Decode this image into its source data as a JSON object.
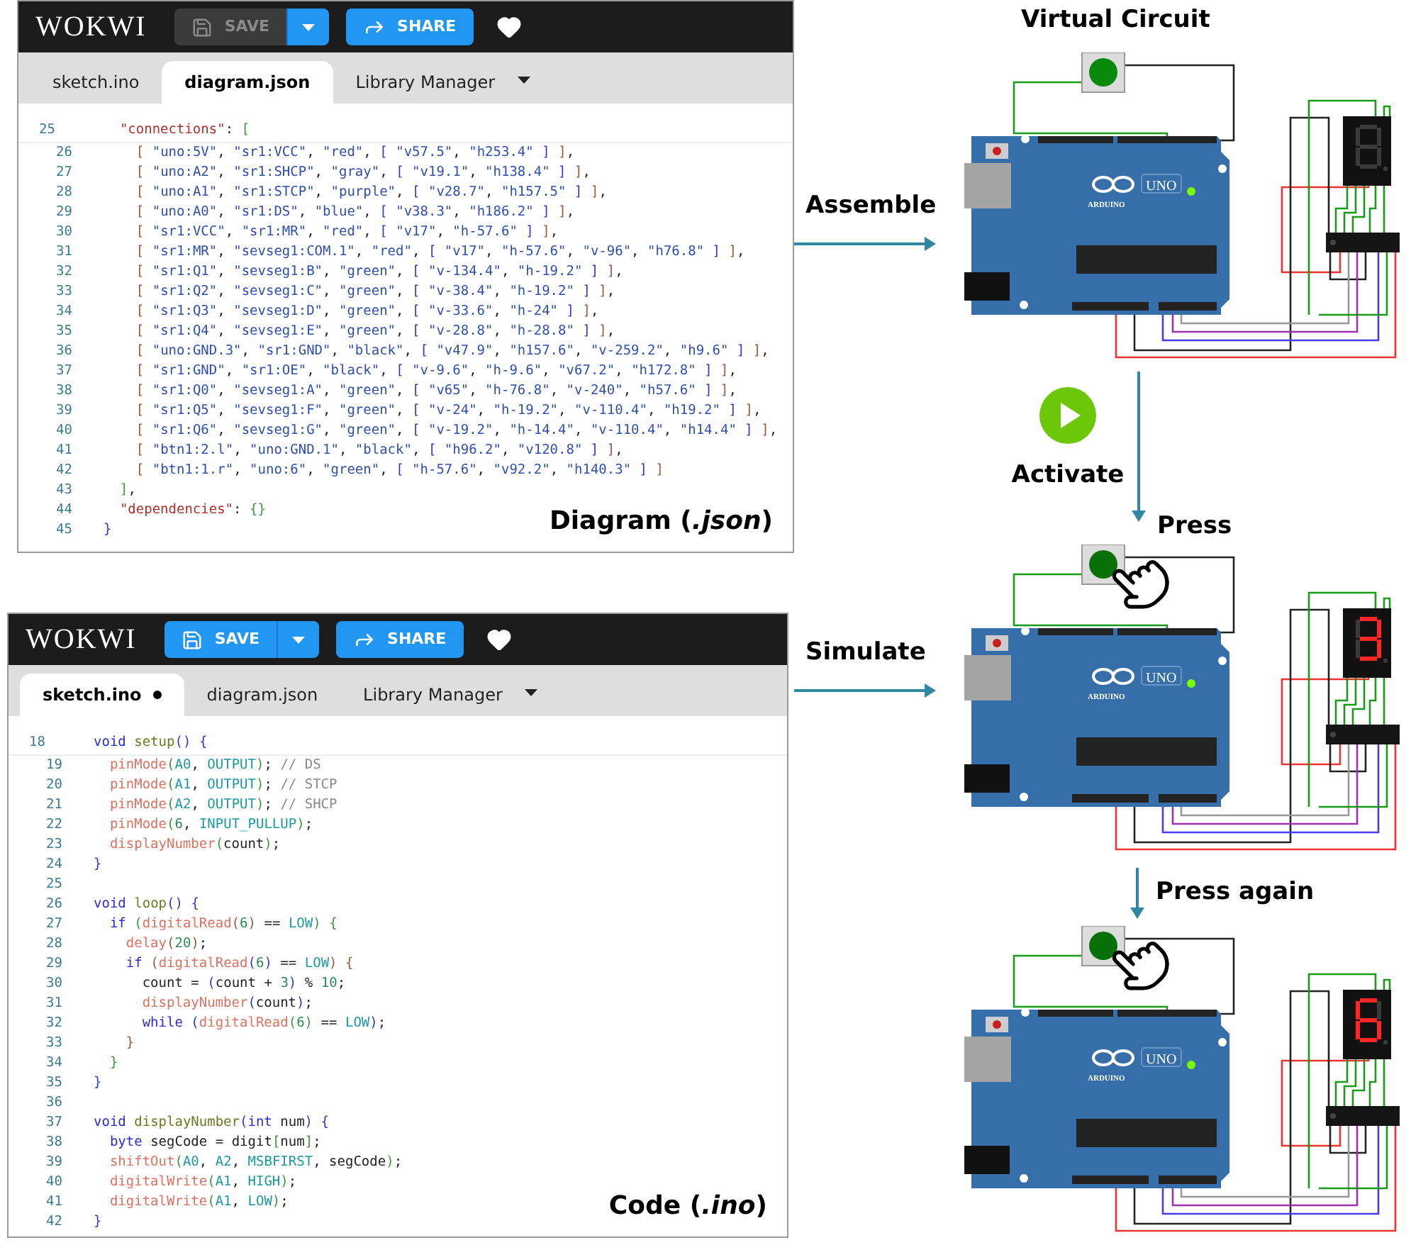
{
  "editors": [
    {
      "kind": "json",
      "logo": "WOKWI",
      "save": {
        "label": "SAVE",
        "disabled": true
      },
      "share": "SHARE",
      "tabs": [
        {
          "label": "sketch.ino",
          "selected": false,
          "modified": false
        },
        {
          "label": "diagram.json",
          "selected": true,
          "modified": false
        },
        {
          "label": "Library Manager",
          "selected": false,
          "modified": false
        }
      ],
      "sticky_line": {
        "number": "25",
        "text": "  \"connections\": ["
      },
      "lines": [
        {
          "number": "26",
          "text": "    [ \"uno:5V\", \"sr1:VCC\", \"red\", [ \"v57.5\", \"h253.4\" ] ],"
        },
        {
          "number": "27",
          "text": "    [ \"uno:A2\", \"sr1:SHCP\", \"gray\", [ \"v19.1\", \"h138.4\" ] ],"
        },
        {
          "number": "28",
          "text": "    [ \"uno:A1\", \"sr1:STCP\", \"purple\", [ \"v28.7\", \"h157.5\" ] ],"
        },
        {
          "number": "29",
          "text": "    [ \"uno:A0\", \"sr1:DS\", \"blue\", [ \"v38.3\", \"h186.2\" ] ],"
        },
        {
          "number": "30",
          "text": "    [ \"sr1:VCC\", \"sr1:MR\", \"red\", [ \"v17\", \"h-57.6\" ] ],"
        },
        {
          "number": "31",
          "text": "    [ \"sr1:MR\", \"sevseg1:COM.1\", \"red\", [ \"v17\", \"h-57.6\", \"v-96\", \"h76.8\" ] ],"
        },
        {
          "number": "32",
          "text": "    [ \"sr1:Q1\", \"sevseg1:B\", \"green\", [ \"v-134.4\", \"h-19.2\" ] ],"
        },
        {
          "number": "33",
          "text": "    [ \"sr1:Q2\", \"sevseg1:C\", \"green\", [ \"v-38.4\", \"h-19.2\" ] ],"
        },
        {
          "number": "34",
          "text": "    [ \"sr1:Q3\", \"sevseg1:D\", \"green\", [ \"v-33.6\", \"h-24\" ] ],"
        },
        {
          "number": "35",
          "text": "    [ \"sr1:Q4\", \"sevseg1:E\", \"green\", [ \"v-28.8\", \"h-28.8\" ] ],"
        },
        {
          "number": "36",
          "text": "    [ \"uno:GND.3\", \"sr1:GND\", \"black\", [ \"v47.9\", \"h157.6\", \"v-259.2\", \"h9.6\" ] ],"
        },
        {
          "number": "37",
          "text": "    [ \"sr1:GND\", \"sr1:OE\", \"black\", [ \"v-9.6\", \"h-9.6\", \"v67.2\", \"h172.8\" ] ],"
        },
        {
          "number": "38",
          "text": "    [ \"sr1:Q0\", \"sevseg1:A\", \"green\", [ \"v65\", \"h-76.8\", \"v-240\", \"h57.6\" ] ],"
        },
        {
          "number": "39",
          "text": "    [ \"sr1:Q5\", \"sevseg1:F\", \"green\", [ \"v-24\", \"h-19.2\", \"v-110.4\", \"h19.2\" ] ],"
        },
        {
          "number": "40",
          "text": "    [ \"sr1:Q6\", \"sevseg1:G\", \"green\", [ \"v-19.2\", \"h-14.4\", \"v-110.4\", \"h14.4\" ] ],"
        },
        {
          "number": "41",
          "text": "    [ \"btn1:2.l\", \"uno:GND.1\", \"black\", [ \"h96.2\", \"v120.8\" ] ],"
        },
        {
          "number": "42",
          "text": "    [ \"btn1:1.r\", \"uno:6\", \"green\", [ \"h-57.6\", \"v92.2\", \"h140.3\" ] ]"
        },
        {
          "number": "43",
          "text": "  ],"
        },
        {
          "number": "44",
          "text": "  \"dependencies\": {}"
        },
        {
          "number": "45",
          "text": "}"
        }
      ],
      "caption": "Diagram (*.json*)"
    },
    {
      "kind": "cpp",
      "logo": "WOKWI",
      "save": {
        "label": "SAVE",
        "disabled": false
      },
      "share": "SHARE",
      "tabs": [
        {
          "label": "sketch.ino",
          "selected": true,
          "modified": true
        },
        {
          "label": "diagram.json",
          "selected": false,
          "modified": false
        },
        {
          "label": "Library Manager",
          "selected": false,
          "modified": false
        }
      ],
      "sticky_line": {
        "number": "18",
        "text": "void setup() {"
      },
      "lines": [
        {
          "number": "19",
          "text": "  pinMode(A0, OUTPUT); // DS"
        },
        {
          "number": "20",
          "text": "  pinMode(A1, OUTPUT); // STCP"
        },
        {
          "number": "21",
          "text": "  pinMode(A2, OUTPUT); // SHCP"
        },
        {
          "number": "22",
          "text": "  pinMode(6, INPUT_PULLUP);"
        },
        {
          "number": "23",
          "text": "  displayNumber(count);"
        },
        {
          "number": "24",
          "text": "}"
        },
        {
          "number": "25"
        },
        {
          "number": "26",
          "text": "void loop() {"
        },
        {
          "number": "27",
          "text": "  if (digitalRead(6) == LOW) {"
        },
        {
          "number": "28",
          "text": "    delay(20);"
        },
        {
          "number": "29",
          "text": "    if (digitalRead(6) == LOW) {"
        },
        {
          "number": "30",
          "text": "      count = (count + 3) % 10;"
        },
        {
          "number": "31",
          "text": "      displayNumber(count);"
        },
        {
          "number": "32",
          "text": "      while (digitalRead(6) == LOW);"
        },
        {
          "number": "33",
          "text": "    }"
        },
        {
          "number": "34",
          "text": "  }"
        },
        {
          "number": "35",
          "text": "}"
        },
        {
          "number": "36"
        },
        {
          "number": "37",
          "text": "void displayNumber(int num) {"
        },
        {
          "number": "38",
          "text": "  byte segCode = digit[num];"
        },
        {
          "number": "39",
          "text": "  shiftOut(A0, A2, MSBFIRST, segCode);"
        },
        {
          "number": "40",
          "text": "  digitalWrite(A1, HIGH);"
        },
        {
          "number": "41",
          "text": "  digitalWrite(A1, LOW);"
        },
        {
          "number": "42",
          "text": "}"
        }
      ],
      "caption": "Code (*.ino*)"
    }
  ],
  "flow": {
    "title": "Virtual Circuit",
    "assemble": "Assemble",
    "activate": "Activate",
    "press": "Press",
    "simulate": "Simulate",
    "press_again": "Press again",
    "circuits": [
      {
        "board_model": "UNO",
        "board_brand": "ARDUINO",
        "pressed": false,
        "segments": {
          "a": false,
          "b": false,
          "c": false,
          "d": false,
          "e": false,
          "f": false,
          "g": false
        }
      },
      {
        "board_model": "UNO",
        "board_brand": "ARDUINO",
        "pressed": true,
        "segments": {
          "a": true,
          "b": true,
          "c": true,
          "d": true,
          "e": false,
          "f": false,
          "g": true
        }
      },
      {
        "board_model": "UNO",
        "board_brand": "ARDUINO",
        "pressed": true,
        "segments": {
          "a": true,
          "b": false,
          "c": true,
          "d": true,
          "e": true,
          "f": true,
          "g": true
        }
      }
    ]
  }
}
